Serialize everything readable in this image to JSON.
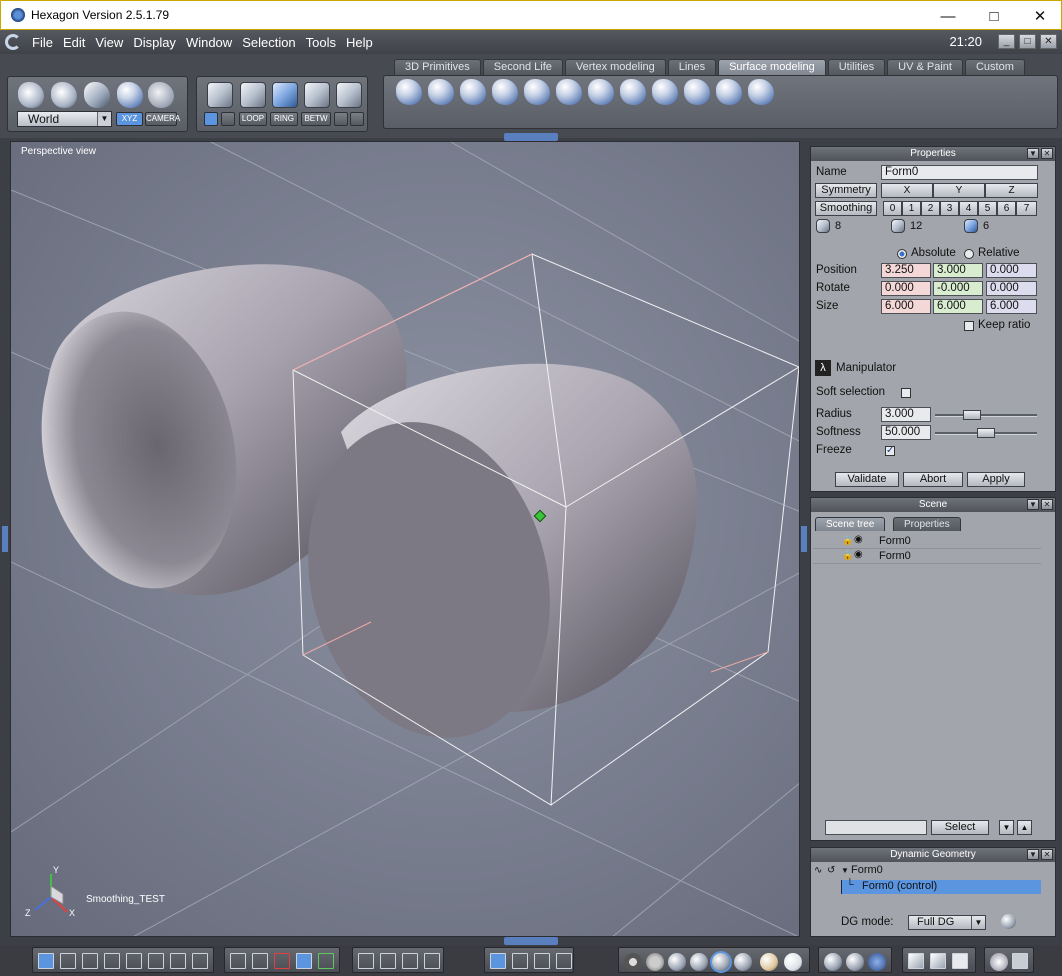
{
  "window": {
    "title": "Hexagon Version 2.5.1.79"
  },
  "menu": {
    "items": [
      "File",
      "Edit",
      "View",
      "Display",
      "Window",
      "Selection",
      "Tools",
      "Help"
    ],
    "clock": "21:20"
  },
  "toolbar": {
    "tabs": [
      "3D Primitives",
      "Second Life",
      "Vertex modeling",
      "Lines",
      "Surface modeling",
      "Utilities",
      "UV & Paint",
      "Custom"
    ],
    "active_tab": "Surface modeling",
    "coord_select": "World",
    "xyz_label": "XYZ",
    "camera_label": "CAMERA",
    "loop_label": "LOOP",
    "ring_label": "RING",
    "betw_label": "BETW"
  },
  "viewport": {
    "label": "Perspective view",
    "object_name": "Smoothing_TEST",
    "axis_x": "X",
    "axis_y": "Y",
    "axis_z": "Z"
  },
  "properties": {
    "title": "Properties",
    "name_label": "Name",
    "name_value": "Form0",
    "symmetry_label": "Symmetry",
    "sym_axes": [
      "X",
      "Y",
      "Z"
    ],
    "smoothing_label": "Smoothing",
    "smoothing_levels": [
      "0",
      "1",
      "2",
      "3",
      "4",
      "5",
      "6",
      "7"
    ],
    "count_vertices": "8",
    "count_edges": "12",
    "count_faces": "6",
    "absolute_label": "Absolute",
    "relative_label": "Relative",
    "position_label": "Position",
    "position": [
      "3.250",
      "3.000",
      "0.000"
    ],
    "rotate_label": "Rotate",
    "rotate": [
      "0.000",
      "-0.000",
      "0.000"
    ],
    "size_label": "Size",
    "size": [
      "6.000",
      "6.000",
      "6.000"
    ],
    "keep_ratio_label": "Keep ratio",
    "manipulator_label": "Manipulator",
    "soft_selection_label": "Soft selection",
    "radius_label": "Radius",
    "radius_value": "3.000",
    "softness_label": "Softness",
    "softness_value": "50.000",
    "freeze_label": "Freeze",
    "validate_label": "Validate",
    "abort_label": "Abort",
    "apply_label": "Apply"
  },
  "scene": {
    "title": "Scene",
    "tabs": [
      "Scene tree",
      "Properties"
    ],
    "items": [
      "Form0",
      "Form0"
    ],
    "select_label": "Select"
  },
  "dg": {
    "title": "Dynamic Geometry",
    "root": "Form0",
    "child": "Form0 (control)",
    "mode_label": "DG mode:",
    "mode_value": "Full DG"
  },
  "colors": {
    "accent": "#5b95df",
    "tab_active": "#8a9099",
    "viewport": "#7a7f90"
  }
}
